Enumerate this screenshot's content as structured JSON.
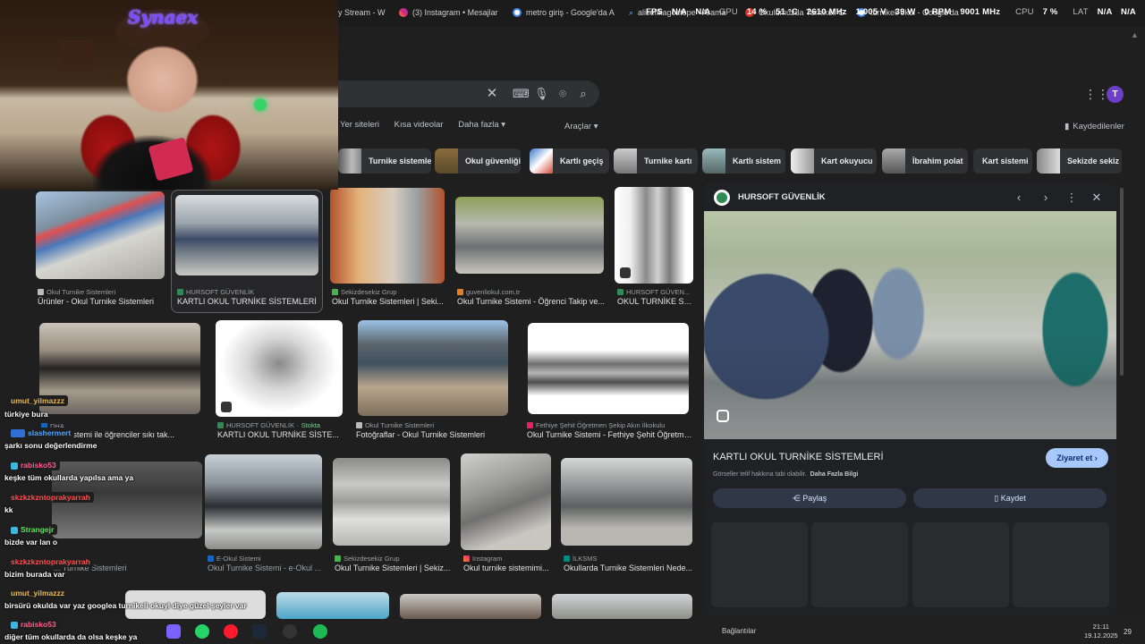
{
  "browser": {
    "tabs": [
      {
        "label": "y Stream - W"
      },
      {
        "label": "(3) Instagram • Mesajlar"
      },
      {
        "label": "metro giriş - Google'da A"
      },
      {
        "label": "alisefikagoztepe - Arama"
      },
      {
        "label": "Okulumuzda Turnikeli G"
      },
      {
        "label": "turnikeli okul - Google'da"
      }
    ]
  },
  "overlay_stats": {
    "fps_label": "FPS",
    "fps_val1": "N/A",
    "fps_val2": "N/A",
    "gpu_label": "GPU",
    "gpu_load": "14 %",
    "gpu_temp": "51 °C",
    "gpu_clock": "2610 MHz",
    "gpu_volt": "1.005 V",
    "gpu_power": "39 W",
    "gpu_rpm": "0 RPM",
    "mem_clock": "9001 MHz",
    "cpu_label": "CPU",
    "cpu_load": "7 %",
    "lat_label": "LAT",
    "lat_val1": "N/A",
    "lat_val2": "N/A"
  },
  "stream": {
    "logo_text": "Synaex"
  },
  "google": {
    "avatar_letter": "T",
    "nav": {
      "tabs": [
        "Yer siteleri",
        "Kısa videolar",
        "Daha fazla ▾"
      ],
      "tools": "Araçlar ▾",
      "saved": "Kaydedilenler"
    },
    "chips": [
      {
        "label": "Turnike sistemleri"
      },
      {
        "label": "Okul güvenliği"
      },
      {
        "label": "Kartlı geçiş"
      },
      {
        "label": "Turnike kartı"
      },
      {
        "label": "Kartlı sistem"
      },
      {
        "label": "Kart okuyucu"
      },
      {
        "label": "İbrahim polat"
      },
      {
        "label": "Kart sistemi"
      },
      {
        "label": "Sekizde sekiz"
      }
    ],
    "results": [
      {
        "source": "Okul Turnike Sistemleri",
        "title": "Ürünler - Okul Turnike Sistemleri"
      },
      {
        "source": "HURSOFT GÜVENLİK",
        "title": "KARTLI OKUL TURNİKE SİSTEMLERİ"
      },
      {
        "source": "Sekizdesekiz Grup",
        "title": "Okul Turnike Sistemleri | Seki..."
      },
      {
        "source": "guvenliokul.com.tr",
        "title": "Okul Turnike Sistemi - Öğrenci Takip ve..."
      },
      {
        "source": "HURSOFT GÜVEN...",
        "title": "OKUL TURNİKE Sİ..."
      },
      {
        "source": "DHA",
        "title": "... nike sistemi ile öğrenciler sıkı tak..."
      },
      {
        "source": "HURSOFT GÜVENLİK · ",
        "stock": "Stokta",
        "title": "KARTLI OKUL TURNİKE SİSTE..."
      },
      {
        "source": "Okul Turnike Sistemleri",
        "title": "Fotoğraflar - Okul Turnike Sistemleri"
      },
      {
        "source": "Fethiye Şehit Öğretmen Şekip Akın İlkokulu",
        "title": "Okul Turnike Sistemi - Fethiye Şehit Öğretme..."
      },
      {
        "source": "",
        "title": "... Turnike Sistemleri"
      },
      {
        "source": "E-Okul Sistemi",
        "title": "Okul Turnike Sistemi - e-Okul ..."
      },
      {
        "source": "Sekizdesekiz Grup",
        "title": "Okul Turnike Sistemleri | Sekiz..."
      },
      {
        "source": "Instagram",
        "title": "Okul turnike sistemimi..."
      },
      {
        "source": "İLKSMS",
        "title": "Okullarda Turnike Sistemleri Nede..."
      }
    ],
    "panel": {
      "source": "HURSOFT GÜVENLİK",
      "caption": "KARTLI OKUL TURNİKE SİSTEMLERİ",
      "visit": "Ziyaret et ›",
      "copyright": "Görseller telif hakkına tabi olabilir.",
      "more_info": "Daha Fazla Bilgi",
      "share": "Paylaş",
      "save": "Kaydet"
    }
  },
  "chat": [
    {
      "name": "umut_yilmazzz",
      "name_color": "#e8b84d",
      "message": "türkiye bura"
    },
    {
      "name": "slashermert",
      "name_color": "#4fa3ff",
      "message": "şarkı sonu değerlendirme"
    },
    {
      "name": "rabisko53",
      "name_color": "#ff5a8a",
      "message": "keşke tüm okullarda yapılsa ama ya"
    },
    {
      "name": "skzkzkzntoprakyarrah",
      "name_color": "#ff4d4d",
      "message": "kk"
    },
    {
      "name": "Strangejr",
      "name_color": "#5ee05e",
      "message": "bizde var lan o"
    },
    {
      "name": "skzkzkzntoprakyarrah",
      "name_color": "#ff4d4d",
      "message": "bizim burada var"
    },
    {
      "name": "umut_yilmazzz",
      "name_color": "#e8b84d",
      "message": "birsürü okulda var yaz googlea turnikeli okuyl diye güzel şeyler var"
    },
    {
      "name": "rabisko53",
      "name_color": "#ff5a8a",
      "message": "diğer tüm okullarda da olsa keşke ya"
    }
  ],
  "taskbar": {
    "network": "Bağlantılar",
    "time": "21:11",
    "date": "19.12.2025",
    "notif": "29"
  }
}
